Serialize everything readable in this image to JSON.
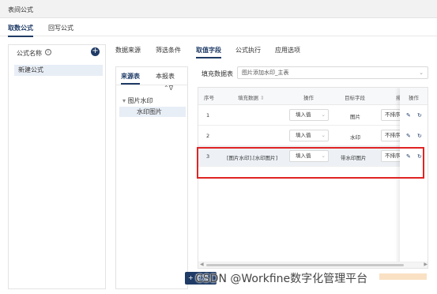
{
  "window": {
    "title": "表间公式"
  },
  "top_tabs": [
    {
      "label": "取数公式",
      "active": true
    },
    {
      "label": "回写公式",
      "active": false
    }
  ],
  "formula_list": {
    "header": "公式名称",
    "items": [
      "新建公式"
    ]
  },
  "sub_tabs": [
    {
      "label": "数据来源",
      "active": false
    },
    {
      "label": "筛选条件",
      "active": false
    },
    {
      "label": "取值字段",
      "active": true
    },
    {
      "label": "公式执行",
      "active": false
    },
    {
      "label": "应用选项",
      "active": false
    }
  ],
  "source_panel": {
    "tabs": [
      {
        "label": "来源表",
        "active": true
      },
      {
        "label": "本报表",
        "active": false
      }
    ],
    "tree_parent": "图片水印",
    "tree_child": "水印图片"
  },
  "fill_table": {
    "label": "填充数据表",
    "value": "图片添加水印_主表"
  },
  "grid": {
    "headers": {
      "seq": "序号",
      "fill_data": "填充数据",
      "operation": "操作",
      "target_field": "目标字段",
      "sort": "排",
      "actions": "操作"
    },
    "rows": [
      {
        "seq": "1",
        "fill_data": "",
        "operation": "填入值",
        "target": "图片",
        "sort": "不排序"
      },
      {
        "seq": "2",
        "fill_data": "",
        "operation": "填入值",
        "target": "水印",
        "sort": "不排序"
      },
      {
        "seq": "3",
        "fill_data": "[图片水印].[水印图片]",
        "operation": "填入值",
        "target": "带水印图片",
        "sort": "不排序"
      }
    ]
  },
  "bottom": {
    "button_label": "+ 添加"
  },
  "watermark": "CSDN @Workfine数字化管理平台",
  "colors": {
    "primary": "#1f3b66",
    "highlight": "#e02424"
  }
}
